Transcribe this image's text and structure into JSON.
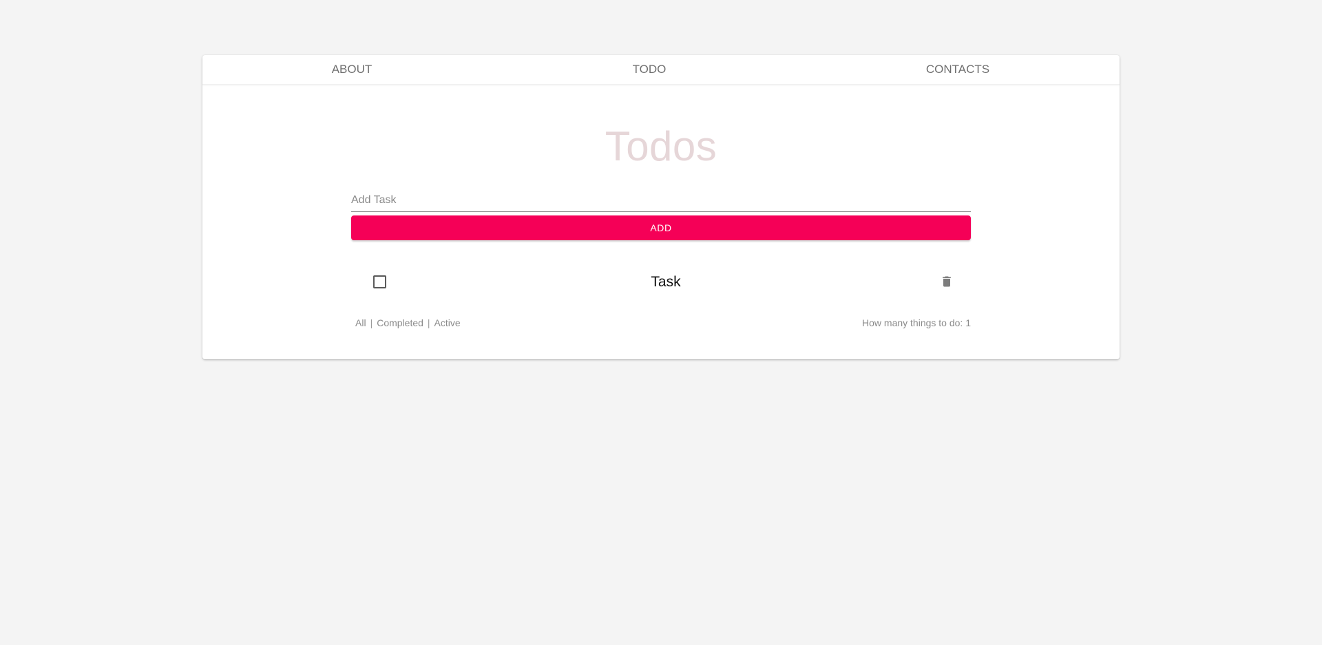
{
  "nav": {
    "tabs": [
      {
        "label": "ABOUT"
      },
      {
        "label": "TODO"
      },
      {
        "label": "CONTACTS"
      }
    ]
  },
  "main": {
    "title": "Todos",
    "input": {
      "placeholder": "Add Task",
      "value": ""
    },
    "add_button_label": "ADD",
    "todos": [
      {
        "text": "Task",
        "completed": false
      }
    ],
    "filters": {
      "all": "All",
      "completed": "Completed",
      "active": "Active",
      "separator": "|"
    },
    "count_label": "How many things to do: 1"
  },
  "colors": {
    "accent": "#f50057",
    "title": "#e6d6d8",
    "background": "#f4f4f4"
  },
  "icons": {
    "checkbox": "checkbox-unchecked-icon",
    "delete": "trash-icon"
  }
}
